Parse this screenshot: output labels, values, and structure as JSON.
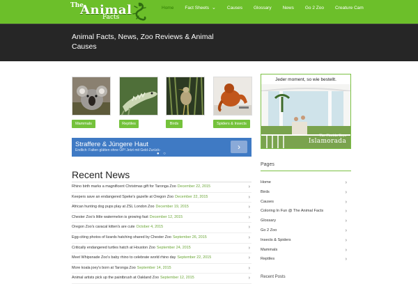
{
  "header": {
    "logo": {
      "top": "The",
      "main": "Animal",
      "sub": "Facts"
    },
    "nav": [
      {
        "label": "Home",
        "active": true,
        "dropdown": false
      },
      {
        "label": "Fact Sheets",
        "active": false,
        "dropdown": true
      },
      {
        "label": "Causes",
        "active": false,
        "dropdown": false
      },
      {
        "label": "Glossary",
        "active": false,
        "dropdown": false
      },
      {
        "label": "News",
        "active": false,
        "dropdown": false
      },
      {
        "label": "Go 2 Zoo",
        "active": false,
        "dropdown": false
      },
      {
        "label": "Creature Cam",
        "active": false,
        "dropdown": false
      }
    ],
    "brand_color": "#6cbf2a"
  },
  "banner": {
    "title": "Animal Facts, News, Zoo Reviews & Animal Causes"
  },
  "categories": [
    {
      "label": "Mammals",
      "icon": "koala-photo"
    },
    {
      "label": "Reptiles",
      "icon": "iguana-photo"
    },
    {
      "label": "Birds",
      "icon": "heron-photo"
    },
    {
      "label": "Spiders & Insects",
      "icon": "orangutan-photo"
    }
  ],
  "ad": {
    "title": "Straffere & Jüngere Haut",
    "subtitle": "Endlich: Falten glätten ohne OP! Jetzt mit Geld-Zurück-",
    "arrow": "›",
    "dots": "● ○"
  },
  "recent_news": {
    "heading": "Recent News",
    "items": [
      {
        "title": "Rhino birth marks a magnificent Christmas gift for Taronga Zoo",
        "date": "December 22, 2015"
      },
      {
        "title": "Keepers save an endangered Speke's gazelle at Oregon Zoo",
        "date": "December 22, 2015"
      },
      {
        "title": "African hunting dog pups play at ZSL London Zoo",
        "date": "December 19, 2015"
      },
      {
        "title": "Chester Zoo's little watermelon is growing fast",
        "date": "December 12, 2015"
      },
      {
        "title": "Oregon Zoo's caracal kitten's are cute",
        "date": "October 4, 2015"
      },
      {
        "title": "Egg-citing photos of lizards hatching shared by Chester Zoo",
        "date": "September 26, 2015"
      },
      {
        "title": "Critically endangered turtles hatch at Houston Zoo",
        "date": "September 24, 2015"
      },
      {
        "title": "Meet Whipsnade Zoo's baby rhino to celebrate world rhino day",
        "date": "September 22, 2015"
      },
      {
        "title": "More koala joey's born at Taronga Zoo",
        "date": "September 14, 2015"
      },
      {
        "title": "Animal artists pick up the paintbrush at Oakland Zoo",
        "date": "September 12, 2015"
      }
    ]
  },
  "sidebar_ad": {
    "headline": "Jeder moment, so wie bestellt.",
    "brand_small": "The Florida Keys",
    "brand_big": "Islamorada"
  },
  "pages": {
    "heading": "Pages",
    "items": [
      "Home",
      "Birds",
      "Causes",
      "Coloring In Fun @ The Animal Facts",
      "Glossary",
      "Go 2 Zoo",
      "Insects & Spiders",
      "Mammals",
      "Reptiles"
    ],
    "next_heading": "Recent Posts"
  }
}
